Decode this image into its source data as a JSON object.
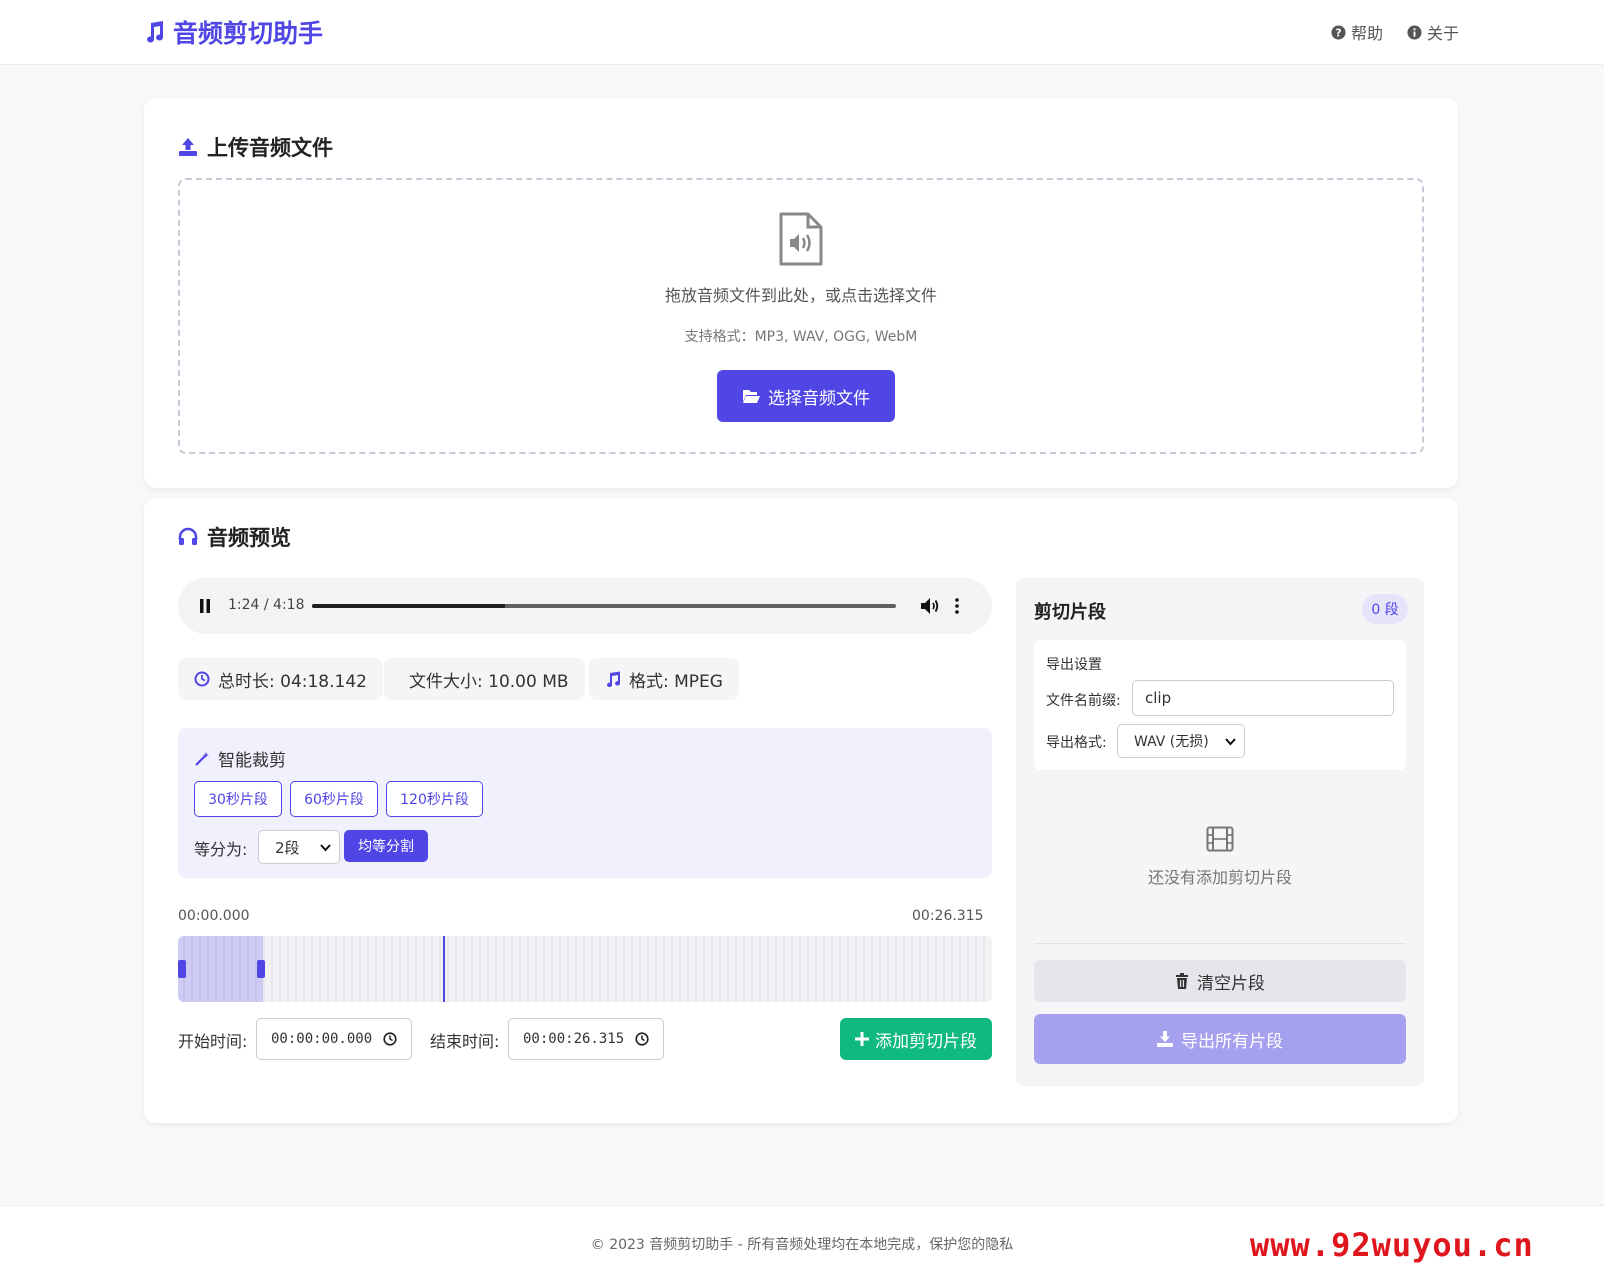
{
  "app": {
    "title": "音频剪切助手",
    "brand_color": "#4f46e5"
  },
  "nav": {
    "help": "帮助",
    "about": "关于"
  },
  "upload": {
    "title": "上传音频文件",
    "drop_text": "拖放音频文件到此处，或点击选择文件",
    "formats_text": "支持格式：MP3, WAV, OGG, WebM",
    "select_button": "选择音频文件"
  },
  "preview": {
    "title": "音频预览",
    "player": {
      "time": "1:24 / 4:18",
      "progress": 0.33
    },
    "stats": {
      "duration": "总时长: 04:18.142",
      "size": "文件大小: 10.00 MB",
      "format": "格式: MPEG"
    },
    "smart_trim": {
      "title": "智能裁剪",
      "chips": [
        "30秒片段",
        "60秒片段",
        "120秒片段"
      ],
      "split_label": "等分为:",
      "split_value": "2段",
      "split_button": "均等分割"
    },
    "timeline": {
      "start_label": "00:00.000",
      "end_label": "00:26.315",
      "selection_end_fraction": 0.105,
      "cursor_fraction": 0.326
    },
    "start_time_label": "开始时间:",
    "start_time_value": "00:00:00.000",
    "end_time_label": "结束时间:",
    "end_time_value": "00:00:26.315",
    "add_button": "添加剪切片段"
  },
  "clips_panel": {
    "title": "剪切片段",
    "count_badge": "0 段",
    "export_settings_title": "导出设置",
    "prefix_label": "文件名前缀:",
    "prefix_value": "clip",
    "format_label": "导出格式:",
    "format_value": "WAV (无损)",
    "empty_text": "还没有添加剪切片段",
    "clear_button": "清空片段",
    "export_button": "导出所有片段"
  },
  "footer": {
    "text": "© 2023 音频剪切助手 - 所有音频处理均在本地完成，保护您的隐私"
  },
  "watermark": {
    "text": "www.92wuyou.cn"
  }
}
